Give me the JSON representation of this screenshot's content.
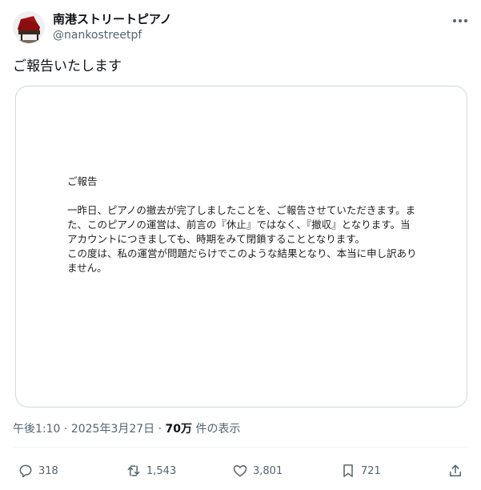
{
  "user": {
    "display_name": "南港ストリートピアノ",
    "handle": "@nankostreetpf"
  },
  "tweet": {
    "text": "ご報告いたします"
  },
  "document": {
    "title": "ご報告",
    "paragraphs": [
      "一昨日、ピアノの撤去が完了しましたことを、ご報告させていただきます。また、このピアノの運営は、前言の『休止』ではなく、『撤収』となります。当アカウントにつきましても、時期をみて閉鎖することとなります。",
      "この度は、私の運営が問題だらけでこのような結果となり、本当に申し訳ありません。"
    ]
  },
  "meta": {
    "time": "午後1:10",
    "date": "2025年3月27日",
    "views_count": "70万",
    "views_label": "件の表示"
  },
  "actions": {
    "replies": "318",
    "reposts": "1,543",
    "likes": "3,801",
    "bookmarks": "721"
  },
  "icons": {
    "avatar": "grand-piano-icon",
    "more": "more-dots-icon",
    "reply": "reply-icon",
    "repost": "repost-icon",
    "like": "heart-icon",
    "bookmark": "bookmark-icon",
    "share": "share-icon"
  }
}
